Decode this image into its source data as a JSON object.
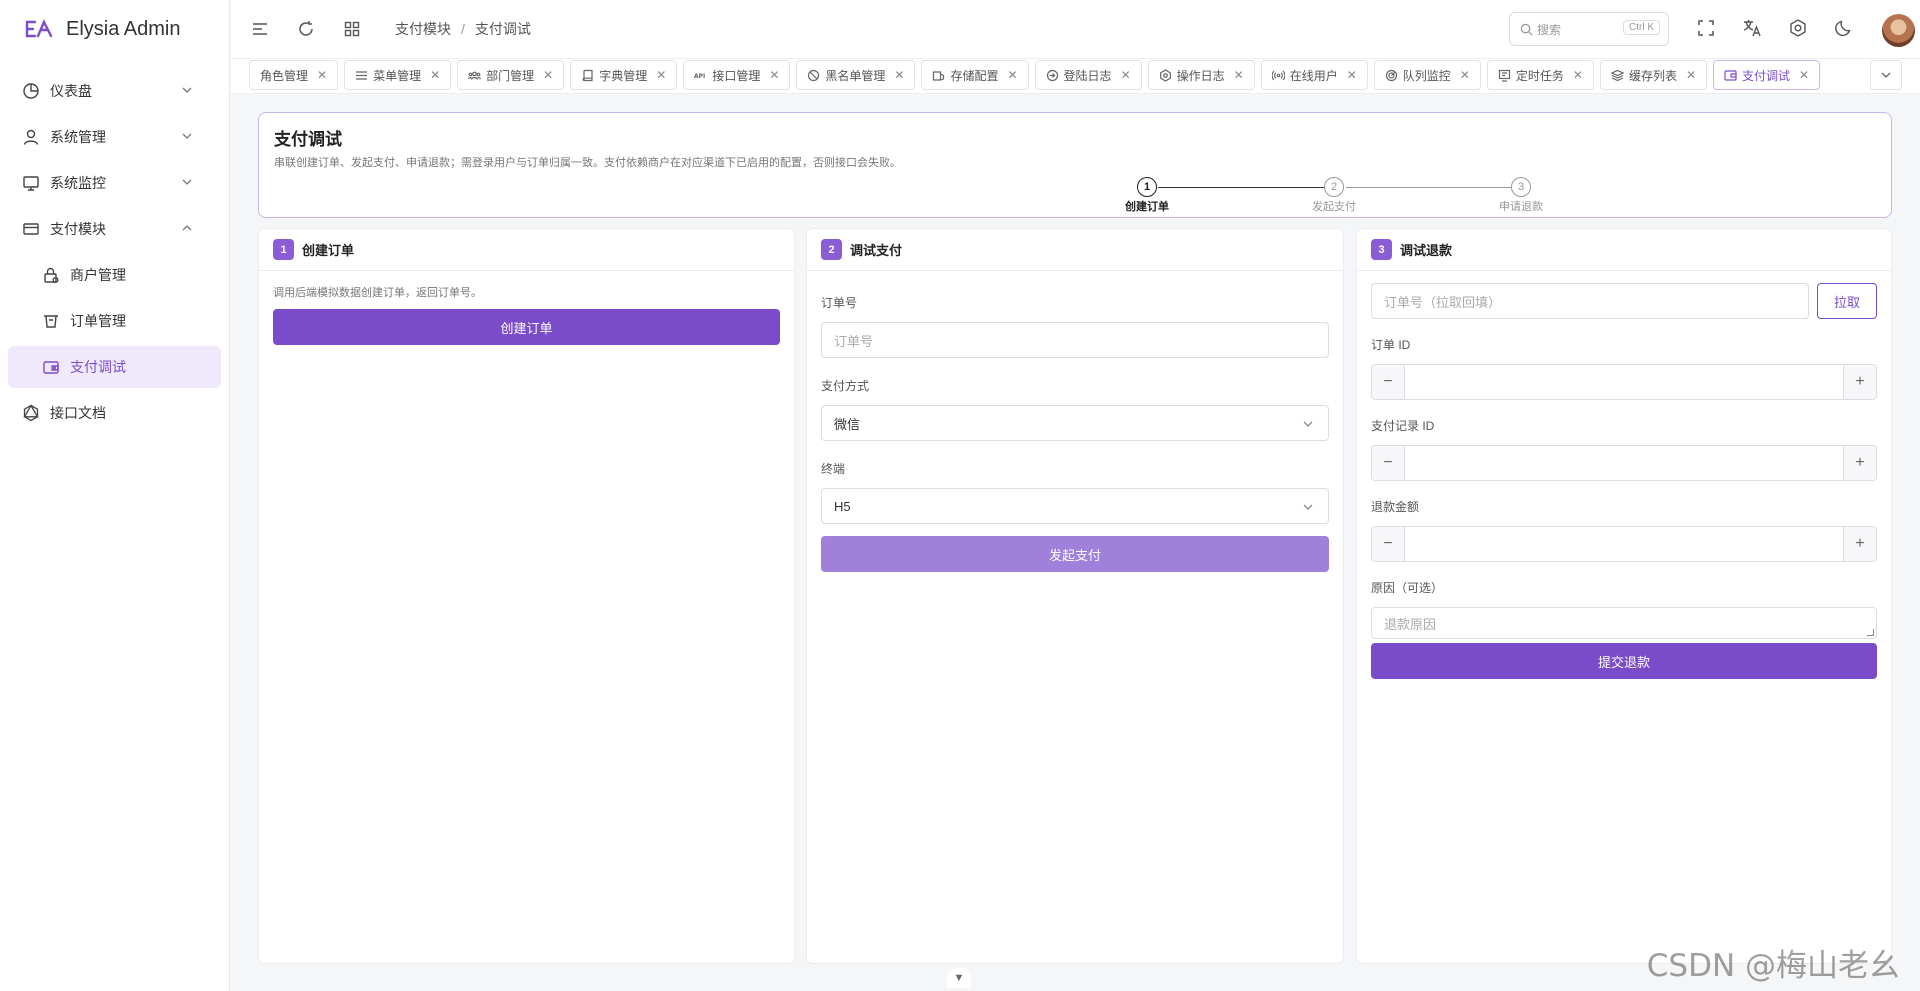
{
  "app": {
    "name": "Elysia Admin",
    "accent": "#7a4cc9"
  },
  "sidebar": {
    "items": [
      {
        "label": "仪表盘",
        "icon": "pie-chart-icon"
      },
      {
        "label": "系统管理",
        "icon": "user-icon"
      },
      {
        "label": "系统监控",
        "icon": "monitor-icon"
      },
      {
        "label": "支付模块",
        "icon": "card-icon"
      },
      {
        "label": "商户管理",
        "icon": "lock-icon"
      },
      {
        "label": "订单管理",
        "icon": "basket-icon"
      },
      {
        "label": "支付调试",
        "icon": "wallet-icon"
      },
      {
        "label": "接口文档",
        "icon": "graphql-icon"
      }
    ]
  },
  "header": {
    "breadcrumb": [
      "支付模块",
      "支付调试"
    ],
    "search_placeholder": "搜索",
    "search_shortcut": "Ctrl K"
  },
  "tabs": [
    {
      "label": "角色管理",
      "icon": "none"
    },
    {
      "label": "菜单管理",
      "icon": "list-icon"
    },
    {
      "label": "部门管理",
      "icon": "team-icon"
    },
    {
      "label": "字典管理",
      "icon": "book-icon"
    },
    {
      "label": "接口管理",
      "icon": "api-icon"
    },
    {
      "label": "黑名单管理",
      "icon": "ban-icon"
    },
    {
      "label": "存储配置",
      "icon": "storage-icon"
    },
    {
      "label": "登陆日志",
      "icon": "login-icon"
    },
    {
      "label": "操作日志",
      "icon": "gear-icon"
    },
    {
      "label": "在线用户",
      "icon": "broadcast-icon"
    },
    {
      "label": "队列监控",
      "icon": "gauge-icon"
    },
    {
      "label": "定时任务",
      "icon": "clock-icon"
    },
    {
      "label": "缓存列表",
      "icon": "layers-icon"
    },
    {
      "label": "支付调试",
      "icon": "wallet-icon"
    }
  ],
  "page": {
    "title": "支付调试",
    "description": "串联创建订单、发起支付、申请退款；需登录用户与订单归属一致。支付依赖商户在对应渠道下已启用的配置，否则接口会失败。",
    "steps": [
      {
        "num": "1",
        "label": "创建订单"
      },
      {
        "num": "2",
        "label": "发起支付"
      },
      {
        "num": "3",
        "label": "申请退款"
      }
    ],
    "current_step": 1
  },
  "panel1": {
    "num": "1",
    "title": "创建订单",
    "hint": "调用后端模拟数据创建订单，返回订单号。",
    "button": "创建订单"
  },
  "panel2": {
    "num": "2",
    "title": "调试支付",
    "order_label": "订单号",
    "order_placeholder": "订单号",
    "method_label": "支付方式",
    "method_value": "微信",
    "terminal_label": "终端",
    "terminal_value": "H5",
    "button": "发起支付"
  },
  "panel3": {
    "num": "3",
    "title": "调试退款",
    "order_placeholder": "订单号（拉取回填）",
    "pull_button": "拉取",
    "order_id_label": "订单 ID",
    "pay_record_label": "支付记录 ID",
    "amount_label": "退款金额",
    "reason_label": "原因（可选）",
    "reason_placeholder": "退款原因",
    "button": "提交退款"
  },
  "watermark": "CSDN @梅山老幺"
}
